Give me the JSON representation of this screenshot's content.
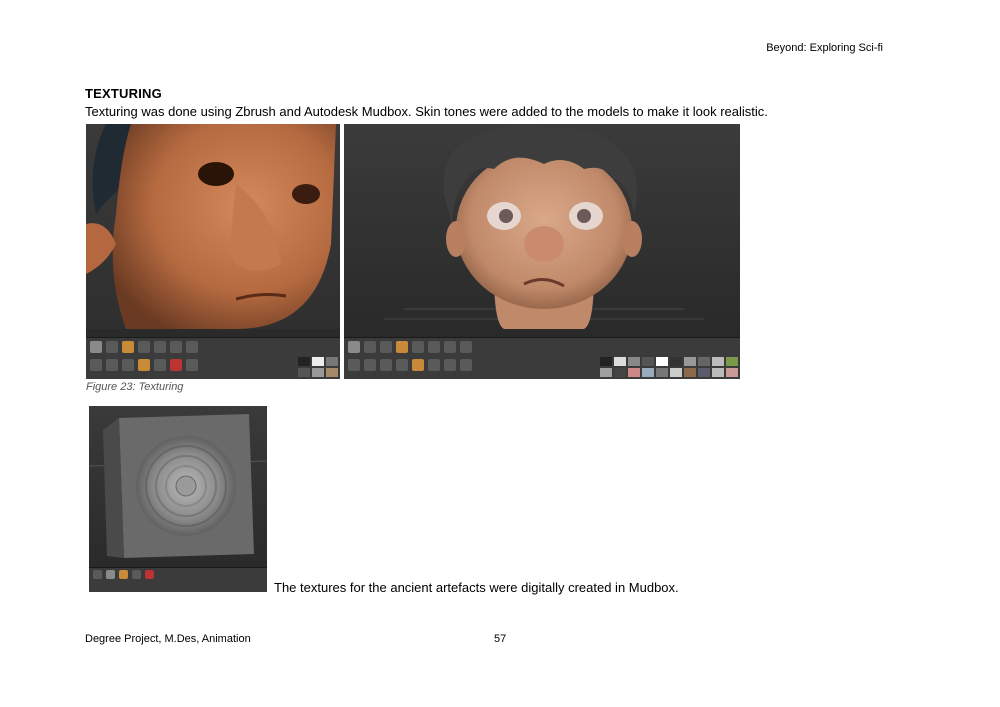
{
  "header": {
    "running_title": "Beyond: Exploring Sci-fi"
  },
  "section": {
    "title": "TEXTURING",
    "intro": "Texturing was done using Zbrush and Autodesk Mudbox. Skin tones were added to the models to make it look realistic."
  },
  "figure": {
    "caption": "Figure 23: Texturing"
  },
  "artefact": {
    "text": "The textures for the ancient artefacts were digitally created in Mudbox."
  },
  "footer": {
    "left": "Degree Project, M.Des, Animation",
    "page": "57"
  }
}
